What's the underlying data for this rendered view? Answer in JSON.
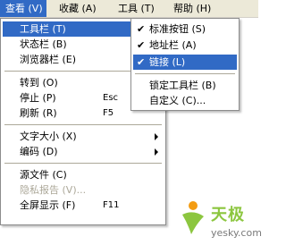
{
  "menubar": {
    "items": [
      {
        "label": "查看 (V)"
      },
      {
        "label": "收藏 (A)"
      },
      {
        "label": "工具 (T)"
      },
      {
        "label": "帮助 (H)"
      }
    ]
  },
  "view_menu": {
    "items": [
      {
        "label": "工具栏 (T)"
      },
      {
        "label": "状态栏 (B)"
      },
      {
        "label": "浏览器栏 (E)"
      },
      {
        "label": "转到 (O)"
      },
      {
        "label": "停止 (P)",
        "shortcut": "Esc"
      },
      {
        "label": "刷新 (R)",
        "shortcut": "F5"
      },
      {
        "label": "文字大小 (X)"
      },
      {
        "label": "编码 (D)"
      },
      {
        "label": "源文件 (C)"
      },
      {
        "label": "隐私报告 (V)..."
      },
      {
        "label": "全屏显示 (F)",
        "shortcut": "F11"
      }
    ]
  },
  "toolbar_submenu": {
    "items": [
      {
        "label": "标准按钮 (S)",
        "check": "✔"
      },
      {
        "label": "地址栏 (A)",
        "check": "✔"
      },
      {
        "label": "链接 (L)",
        "check": "✔"
      },
      {
        "label": "锁定工具栏 (B)"
      },
      {
        "label": "自定义 (C)..."
      }
    ]
  },
  "watermark": {
    "brand": "天极",
    "domain": "yesky.com"
  },
  "colors": {
    "highlight": "#316ac5",
    "menubar": "#ece9d8",
    "disabled": "#aca899"
  }
}
